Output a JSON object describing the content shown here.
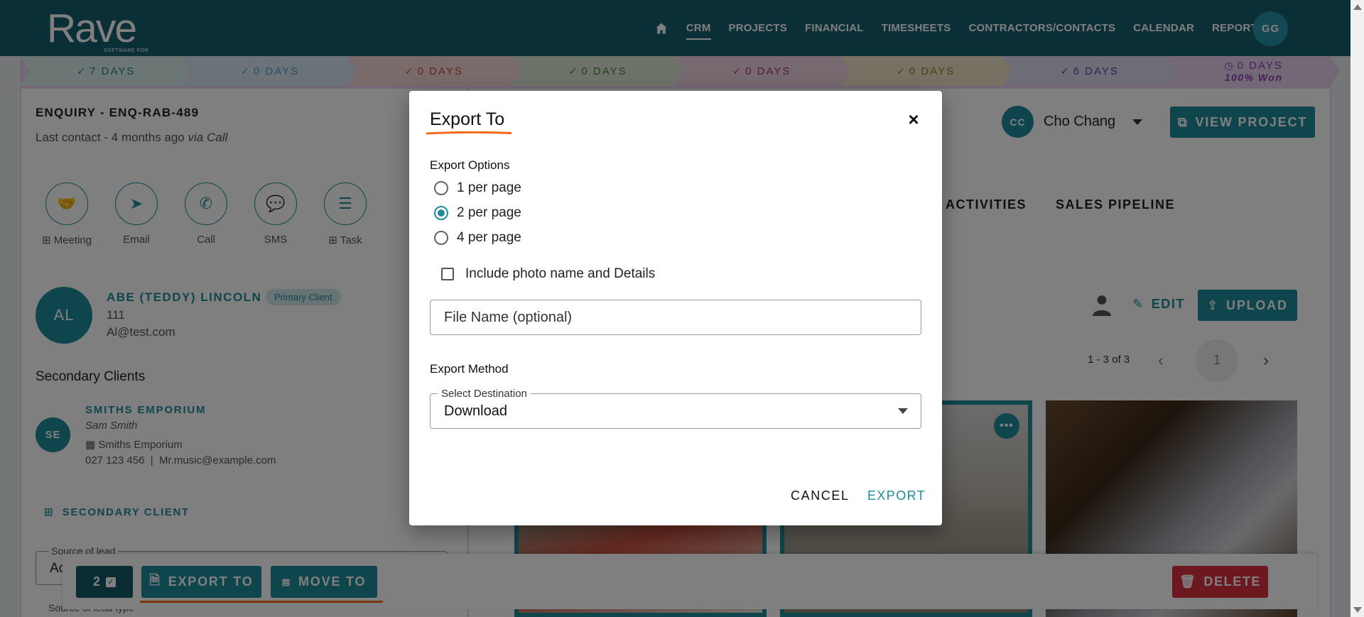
{
  "app": {
    "logo_text": "Rave",
    "logo_tagline": "SOFTWARE FOR",
    "nav": [
      "CRM",
      "PROJECTS",
      "FINANCIAL",
      "TIMESHEETS",
      "CONTRACTORS/CONTACTS",
      "CALENDAR",
      "REPORTING"
    ],
    "user_initials": "GG"
  },
  "stages": [
    {
      "label": "7 DAYS",
      "color": "#2a7f8a",
      "bg": "#d9ecea"
    },
    {
      "label": "0 DAYS",
      "color": "#4b9fc5",
      "bg": "#d6e6f0"
    },
    {
      "label": "0 DAYS",
      "color": "#c9483e",
      "bg": "#f0d6d3"
    },
    {
      "label": "0 DAYS",
      "color": "#4d7e3a",
      "bg": "#dae7d2"
    },
    {
      "label": "0 DAYS",
      "color": "#a8356e",
      "bg": "#edd3e1"
    },
    {
      "label": "0 DAYS",
      "color": "#9a7b1d",
      "bg": "#ede3c6"
    },
    {
      "label": "6 DAYS",
      "color": "#5a49a0",
      "bg": "#dcd8ee"
    },
    {
      "label": "0 DAYS",
      "sub": "100% Won",
      "color": "#8a3fb5",
      "bg": "#e6d1ec"
    }
  ],
  "enquiry": {
    "title": "ENQUIRY - ENQ-RAB-489",
    "last_contact": "Last contact - 4 months ago",
    "via": "via Call"
  },
  "actions": [
    {
      "label": "Meeting",
      "prefix": "⊞ "
    },
    {
      "label": "Email",
      "prefix": ""
    },
    {
      "label": "Call",
      "prefix": ""
    },
    {
      "label": "SMS",
      "prefix": ""
    },
    {
      "label": "Task",
      "prefix": "⊞ "
    }
  ],
  "client": {
    "initials": "AL",
    "name": "ABE (TEDDY) LINCOLN",
    "badge": "Primary Client",
    "phone": "111",
    "email": "Al@test.com"
  },
  "secondary": {
    "heading": "Secondary Clients",
    "initials": "SE",
    "name": "SMITHS EMPORIUM",
    "contact": "Sam Smith",
    "company": "Smiths Emporium",
    "phone": "027 123 456",
    "email": "Mr.music@example.com",
    "add_label": "SECONDARY CLIENT"
  },
  "source": {
    "label": "Source of lead",
    "value": "Ac",
    "label2": "Source of lead type"
  },
  "owner": {
    "initials": "CC",
    "name": "Cho Chang"
  },
  "right": {
    "view_project": "VIEW PROJECT",
    "tab_activities": "Y ACTIVITIES",
    "tab_pipeline": "SALES PIPELINE",
    "edit": "EDIT",
    "upload": "UPLOAD",
    "pager_text": "1 - 3 of 3",
    "pager_page": "1"
  },
  "bottom_bar": {
    "count": "2",
    "export_to": "EXPORT TO",
    "move_to": "MOVE TO",
    "delete": "DELETE"
  },
  "modal": {
    "title": "Export To",
    "options_heading": "Export Options",
    "options": [
      "1 per page",
      "2 per page",
      "4 per page"
    ],
    "selected_option": "2 per page",
    "include_label": "Include photo name and Details",
    "file_name_placeholder": "File Name (optional)",
    "method_heading": "Export Method",
    "destination_label": "Select Destination",
    "destination_value": "Download",
    "cancel": "CANCEL",
    "export": "EXPORT"
  },
  "colors": {
    "brand": "#155e6f",
    "accent": "#1f8a99",
    "danger": "#d9303c",
    "highlight": "#f26b1d"
  }
}
